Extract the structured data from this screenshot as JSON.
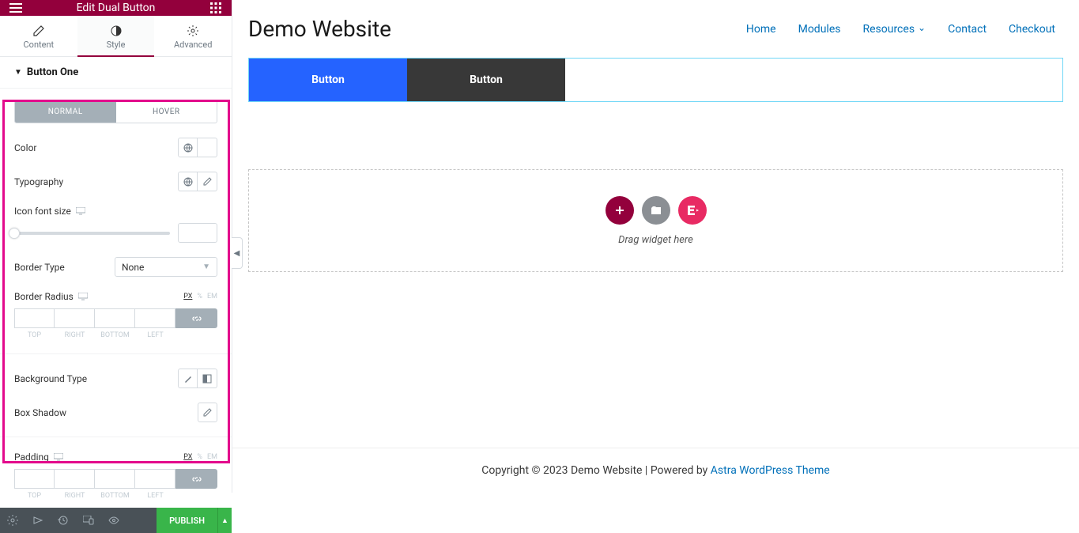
{
  "panel": {
    "title": "Edit Dual Button",
    "tabs": {
      "content": "Content",
      "style": "Style",
      "advanced": "Advanced"
    },
    "section": "Button One",
    "state_tabs": {
      "normal": "NORMAL",
      "hover": "HOVER"
    },
    "props": {
      "color": "Color",
      "typography": "Typography",
      "icon_font_size": "Icon font size",
      "border_type": "Border Type",
      "border_type_value": "None",
      "border_radius": "Border Radius",
      "background_type": "Background Type",
      "box_shadow": "Box Shadow",
      "padding": "Padding"
    },
    "units": {
      "px": "PX",
      "pct": "%",
      "em": "EM"
    },
    "sides": {
      "top": "TOP",
      "right": "RIGHT",
      "bottom": "BOTTOM",
      "left": "LEFT"
    },
    "publish": "PUBLISH"
  },
  "site": {
    "title": "Demo Website",
    "nav": {
      "home": "Home",
      "modules": "Modules",
      "resources": "Resources",
      "contact": "Contact",
      "checkout": "Checkout"
    },
    "buttons": {
      "one": "Button",
      "two": "Button"
    },
    "drop_hint": "Drag widget here",
    "footer_text": "Copyright © 2023 Demo Website | Powered by ",
    "footer_link": "Astra WordPress Theme"
  }
}
